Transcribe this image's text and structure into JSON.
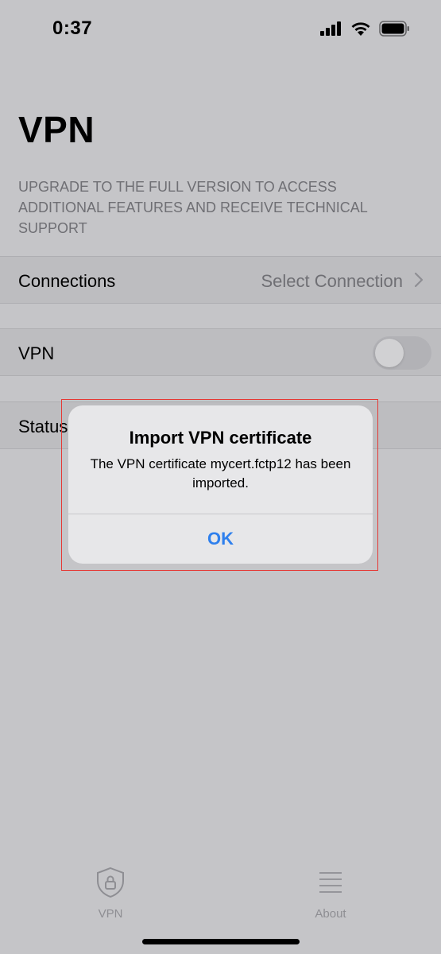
{
  "status_bar": {
    "time": "0:37",
    "icons": [
      "cellular-signal-icon",
      "wifi-icon",
      "battery-icon"
    ]
  },
  "page": {
    "title": "VPN",
    "upgrade_note": "UPGRADE TO THE FULL VERSION TO ACCESS ADDITIONAL FEATURES AND RECEIVE TECHNICAL SUPPORT"
  },
  "rows": {
    "connections": {
      "label": "Connections",
      "value": "Select Connection"
    },
    "vpn": {
      "label": "VPN",
      "enabled": false
    },
    "status": {
      "label": "Status"
    }
  },
  "alert": {
    "title": "Import VPN certificate",
    "message": "The VPN certificate mycert.fctp12 has been imported.",
    "ok_label": "OK"
  },
  "tabs": [
    {
      "label": "VPN",
      "icon": "shield-lock-icon"
    },
    {
      "label": "About",
      "icon": "list-icon"
    }
  ],
  "colors": {
    "accent": "#2f80ed",
    "highlight_outline": "#e53935",
    "dimmed_background": "#c5c5c8"
  }
}
